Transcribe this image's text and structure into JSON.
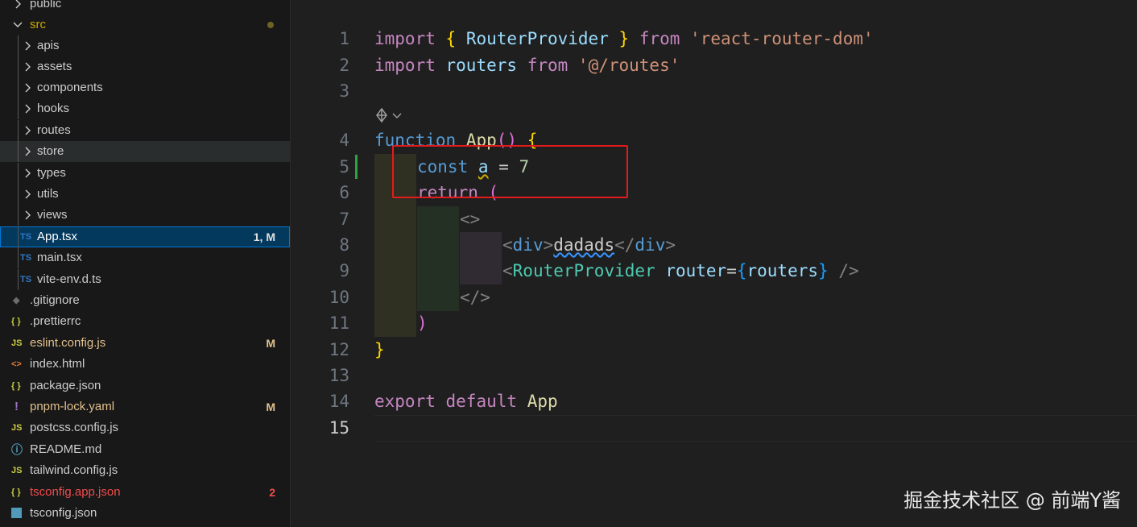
{
  "explorer": {
    "items": [
      {
        "label": "public",
        "icon": "chevron-right-icon",
        "badge": ""
      },
      {
        "label": "src",
        "icon": "chevron-down-icon",
        "badge": ""
      },
      {
        "label": "apis",
        "icon": "chevron-right-icon",
        "badge": ""
      },
      {
        "label": "assets",
        "icon": "chevron-right-icon",
        "badge": ""
      },
      {
        "label": "components",
        "icon": "chevron-right-icon",
        "badge": ""
      },
      {
        "label": "hooks",
        "icon": "chevron-right-icon",
        "badge": ""
      },
      {
        "label": "routes",
        "icon": "chevron-right-icon",
        "badge": ""
      },
      {
        "label": "store",
        "icon": "chevron-right-icon",
        "badge": ""
      },
      {
        "label": "types",
        "icon": "chevron-right-icon",
        "badge": ""
      },
      {
        "label": "utils",
        "icon": "chevron-right-icon",
        "badge": ""
      },
      {
        "label": "views",
        "icon": "chevron-right-icon",
        "badge": ""
      },
      {
        "label": "App.tsx",
        "icon_text": "TS",
        "badge": "1, M"
      },
      {
        "label": "main.tsx",
        "icon_text": "TS",
        "badge": ""
      },
      {
        "label": "vite-env.d.ts",
        "icon_text": "TS",
        "badge": ""
      },
      {
        "label": ".gitignore",
        "icon_text": "◆",
        "badge": ""
      },
      {
        "label": ".prettierrc",
        "icon_text": "{ }",
        "badge": ""
      },
      {
        "label": "eslint.config.js",
        "icon_text": "JS",
        "badge": "M"
      },
      {
        "label": "index.html",
        "icon_text": "<>",
        "badge": ""
      },
      {
        "label": "package.json",
        "icon_text": "{ }",
        "badge": ""
      },
      {
        "label": "pnpm-lock.yaml",
        "icon_text": "!",
        "badge": "M"
      },
      {
        "label": "postcss.config.js",
        "icon_text": "JS",
        "badge": ""
      },
      {
        "label": "README.md",
        "icon_text": "ⓘ",
        "badge": ""
      },
      {
        "label": "tailwind.config.js",
        "icon_text": "JS",
        "badge": ""
      },
      {
        "label": "tsconfig.app.json",
        "icon_text": "{ }",
        "badge": "2"
      },
      {
        "label": "tsconfig.json",
        "icon_text": "TS",
        "badge": ""
      }
    ]
  },
  "editor": {
    "line_numbers": [
      "1",
      "2",
      "3",
      "4",
      "5",
      "6",
      "7",
      "8",
      "9",
      "10",
      "11",
      "12",
      "13",
      "14",
      "15"
    ],
    "active_line": "15",
    "codelens_icon": "copilot-icon",
    "code": {
      "l1": [
        "import",
        "{",
        "RouterProvider",
        "}",
        "from",
        "'react-router-dom'"
      ],
      "l2": [
        "import",
        "routers",
        "from",
        "'@/routes'"
      ],
      "l4": [
        "function",
        "App",
        "()",
        "{"
      ],
      "l5": [
        "const",
        "a",
        "=",
        "7"
      ],
      "l6": [
        "return",
        "("
      ],
      "l7": [
        "<>"
      ],
      "l8": [
        "<",
        "div",
        ">",
        "dadads",
        "</",
        "div",
        ">"
      ],
      "l9": [
        "<",
        "RouterProvider",
        "router",
        "=",
        "{",
        "routers",
        "}",
        "/>"
      ],
      "l10": [
        "</>"
      ],
      "l11": [
        ")"
      ],
      "l12": [
        "}"
      ],
      "l14": [
        "export",
        "default",
        "App"
      ]
    }
  },
  "colors": {
    "highlight_box": "#e51b1b",
    "modified_gutter": "#2ea043"
  },
  "watermark": "掘金技术社区 @ 前端Y酱"
}
